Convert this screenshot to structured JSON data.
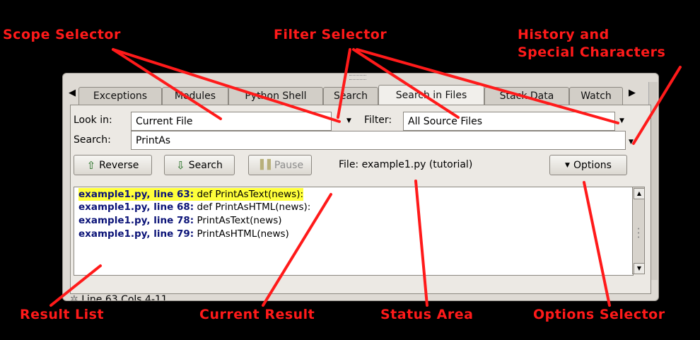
{
  "callouts": {
    "scope": "Scope Selector",
    "filter": "Filter Selector",
    "history_line1": "History and",
    "history_line2": "Special Characters",
    "results": "Result List",
    "current": "Current Result",
    "status": "Status Area",
    "options": "Options Selector"
  },
  "tabs": [
    {
      "label": "Exceptions"
    },
    {
      "label": "Modules"
    },
    {
      "label": "Python Shell"
    },
    {
      "label": "Search"
    },
    {
      "label": "Search in Files",
      "active": true
    },
    {
      "label": "Stack Data"
    },
    {
      "label": "Watch"
    }
  ],
  "form": {
    "look_in_label": "Look in:",
    "look_in_value": "Current File",
    "filter_label": "Filter:",
    "filter_value": "All Source Files",
    "search_label": "Search:",
    "search_value": "PrintAs"
  },
  "buttons": {
    "reverse": "Reverse",
    "search": "Search",
    "pause": "Pause",
    "options": "Options"
  },
  "status": "File: example1.py (tutorial)",
  "results": [
    {
      "location": "example1.py, line 63:",
      "text": " def PrintAsText(news):",
      "current": true
    },
    {
      "location": "example1.py, line 68:",
      "text": " def PrintAsHTML(news):"
    },
    {
      "location": "example1.py, line 78:",
      "text": " PrintAsText(news)"
    },
    {
      "location": "example1.py, line 79:",
      "text": " PrintAsHTML(news)"
    }
  ],
  "statusline": "Line 63 Cols 4-11",
  "colors": {
    "callout": "#ff1a1a",
    "highlight": "#ffff3b",
    "location": "#0c1478"
  }
}
